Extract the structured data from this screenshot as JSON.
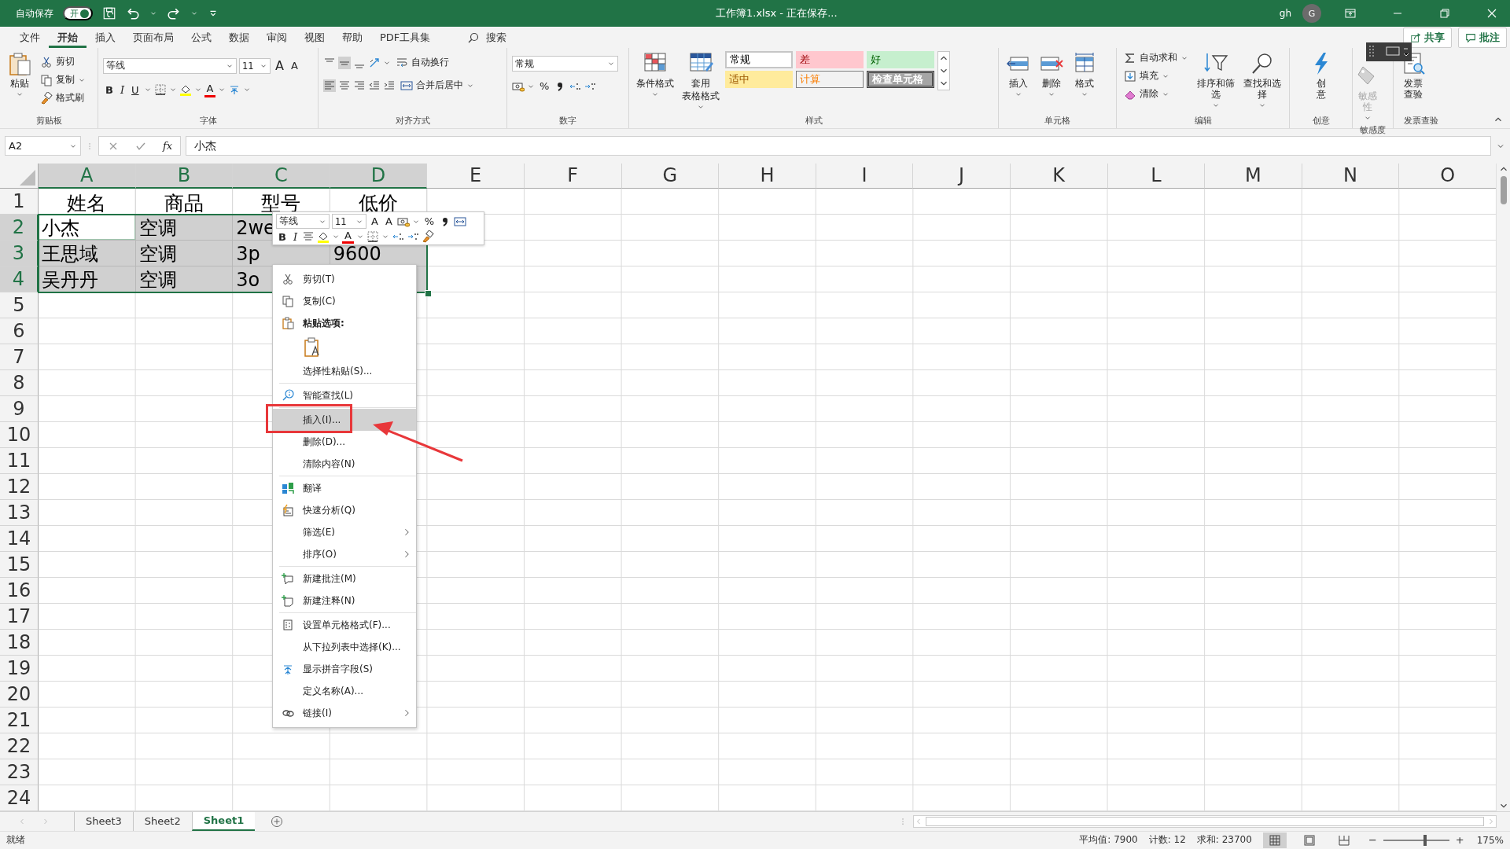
{
  "title_bar": {
    "autosave_label": "自动保存",
    "autosave": {
      "label": "开",
      "on": true
    },
    "document_title": "工作簿1.xlsx - 正在保存...",
    "user": "gh",
    "avatar": "G"
  },
  "menu_tabs": [
    {
      "label": "文件",
      "selected": false
    },
    {
      "label": "开始",
      "selected": true
    },
    {
      "label": "插入",
      "selected": false
    },
    {
      "label": "页面布局",
      "selected": false
    },
    {
      "label": "公式",
      "selected": false
    },
    {
      "label": "数据",
      "selected": false
    },
    {
      "label": "审阅",
      "selected": false
    },
    {
      "label": "视图",
      "selected": false
    },
    {
      "label": "帮助",
      "selected": false
    },
    {
      "label": "PDF工具集",
      "selected": false
    }
  ],
  "search": {
    "label": "搜索"
  },
  "share_button": "共享",
  "comment_button": "批注",
  "ribbon": {
    "clipboard": {
      "label": "剪贴板",
      "paste": "粘贴",
      "cut": "剪切",
      "copy": "复制",
      "format_painter": "格式刷"
    },
    "font": {
      "label": "字体",
      "font_name": "等线",
      "font_size": "11",
      "grow": "A",
      "shrink": "A",
      "bold": "B",
      "italic": "I",
      "underline": "U",
      "font_color": "A"
    },
    "alignment": {
      "label": "对齐方式",
      "wrap_text": "自动换行",
      "merge_center": "合并后居中"
    },
    "number": {
      "label": "数字",
      "format": "常规",
      "percent": "%"
    },
    "styles": {
      "label": "样式",
      "conditional_formatting": "条件格式",
      "format_as_table": [
        "套用",
        "表格格式"
      ],
      "cell_styles": [
        {
          "label": "常规",
          "kind": "normal"
        },
        {
          "label": "差",
          "kind": "bad"
        },
        {
          "label": "好",
          "kind": "good"
        },
        {
          "label": "适中",
          "kind": "neutral"
        },
        {
          "label": "计算",
          "kind": "calculation"
        },
        {
          "label": "检查单元格",
          "kind": "check"
        }
      ]
    },
    "cells": {
      "label": "单元格",
      "insert": "插入",
      "delete": "删除",
      "format": "格式"
    },
    "editing": {
      "label": "编辑",
      "autosum": "自动求和",
      "fill": "填充",
      "clear": "清除",
      "sort_filter": "排序和筛选",
      "find_select": "查找和选择"
    },
    "ideas": {
      "label": "创意",
      "button": "创意"
    },
    "sensitivity": {
      "label": "敏感度",
      "button": "敏感性",
      "disabled": true
    },
    "invoice": {
      "label": "发票查验",
      "button": "发票查验"
    }
  },
  "formula_bar": {
    "name_box": "A2",
    "function_label": "fx",
    "formula": "小杰"
  },
  "sheet": {
    "columns": [
      {
        "label": "A",
        "selected": true
      },
      {
        "label": "B",
        "selected": true
      },
      {
        "label": "C",
        "selected": true
      },
      {
        "label": "D",
        "selected": true
      },
      {
        "label": "E",
        "selected": false
      },
      {
        "label": "F",
        "selected": false
      },
      {
        "label": "G",
        "selected": false
      },
      {
        "label": "H",
        "selected": false
      },
      {
        "label": "I",
        "selected": false
      },
      {
        "label": "J",
        "selected": false
      },
      {
        "label": "K",
        "selected": false
      },
      {
        "label": "L",
        "selected": false
      },
      {
        "label": "M",
        "selected": false
      },
      {
        "label": "N",
        "selected": false
      },
      {
        "label": "O",
        "selected": false
      }
    ],
    "rows": [
      {
        "label": "1",
        "selected": false,
        "cells": [
          {
            "text": "姓名",
            "selected": false,
            "active": false
          },
          {
            "text": "商品",
            "selected": false,
            "active": false
          },
          {
            "text": "型号",
            "selected": false,
            "active": false
          },
          {
            "text": "低价",
            "selected": false,
            "active": false
          }
        ]
      },
      {
        "label": "2",
        "selected": true,
        "cells": [
          {
            "text": "小杰",
            "selected": true,
            "active": true
          },
          {
            "text": "空调",
            "selected": true,
            "active": false
          },
          {
            "text": "2we",
            "selected": true,
            "active": false
          }
        ]
      },
      {
        "label": "3",
        "selected": true,
        "cells": [
          {
            "text": "王思域",
            "selected": true,
            "active": false
          },
          {
            "text": "空调",
            "selected": true,
            "active": false
          },
          {
            "text": "3p",
            "selected": true,
            "active": false
          },
          {
            "text": "9600",
            "selected": true,
            "active": false
          }
        ]
      },
      {
        "label": "4",
        "selected": true,
        "cells": [
          {
            "text": "吴丹丹",
            "selected": true,
            "active": false
          },
          {
            "text": "空调",
            "selected": true,
            "active": false
          },
          {
            "text": "3o",
            "selected": true,
            "active": false
          },
          {
            "selected": true,
            "active": false
          }
        ]
      },
      {
        "label": "5",
        "selected": false
      },
      {
        "label": "6",
        "selected": false
      },
      {
        "label": "7",
        "selected": false
      },
      {
        "label": "8",
        "selected": false
      },
      {
        "label": "9",
        "selected": false
      },
      {
        "label": "10",
        "selected": false
      },
      {
        "label": "11",
        "selected": false
      },
      {
        "label": "12",
        "selected": false
      },
      {
        "label": "13",
        "selected": false
      },
      {
        "label": "14",
        "selected": false
      },
      {
        "label": "15",
        "selected": false
      },
      {
        "label": "16",
        "selected": false
      },
      {
        "label": "17",
        "selected": false
      },
      {
        "label": "18",
        "selected": false
      },
      {
        "label": "19",
        "selected": false
      },
      {
        "label": "20",
        "selected": false
      },
      {
        "label": "21",
        "selected": false
      },
      {
        "label": "22",
        "selected": false
      },
      {
        "label": "23",
        "selected": false
      },
      {
        "label": "24",
        "selected": false
      }
    ]
  },
  "mini_toolbar": {
    "font_name": "等线",
    "font_size": "11",
    "grow": "A",
    "shrink": "A",
    "percent": "%",
    "bold": "B",
    "italic": "I",
    "font_color": "A"
  },
  "context_menu": {
    "groups": [
      {
        "items": [
          {
            "kind": "cut",
            "label": "剪切(T)",
            "selected": false
          },
          {
            "kind": "copy",
            "label": "复制(C)",
            "selected": false
          },
          {
            "kind": "paste_heading",
            "label": "粘贴选项:"
          },
          {
            "kind": "paste_option"
          },
          {
            "kind": "plain",
            "label": "选择性粘贴(S)...",
            "selected": false
          }
        ]
      },
      {
        "items": [
          {
            "kind": "lookup",
            "label": "智能查找(L)",
            "selected": false
          }
        ]
      },
      {
        "items": [
          {
            "kind": "plain",
            "label": "插入(I)...",
            "selected": true
          },
          {
            "kind": "plain",
            "label": "删除(D)...",
            "selected": false
          },
          {
            "kind": "plain",
            "label": "清除内容(N)",
            "selected": false
          }
        ]
      },
      {
        "items": [
          {
            "kind": "translate",
            "label": "翻译",
            "selected": false
          },
          {
            "kind": "analysis",
            "label": "快速分析(Q)",
            "selected": false
          },
          {
            "kind": "plain",
            "label": "筛选(E)",
            "selected": false,
            "submenu": true
          },
          {
            "kind": "plain",
            "label": "排序(O)",
            "selected": false,
            "submenu": true
          }
        ]
      },
      {
        "items": [
          {
            "kind": "comment",
            "label": "新建批注(M)",
            "selected": false
          },
          {
            "kind": "note",
            "label": "新建注释(N)",
            "selected": false
          }
        ]
      },
      {
        "items": [
          {
            "kind": "format",
            "label": "设置单元格格式(F)...",
            "selected": false
          },
          {
            "kind": "plain",
            "label": "从下拉列表中选择(K)...",
            "selected": false
          },
          {
            "kind": "phonetic",
            "label": "显示拼音字段(S)",
            "selected": false
          },
          {
            "kind": "plain",
            "label": "定义名称(A)...",
            "selected": false
          },
          {
            "kind": "link",
            "label": "链接(I)",
            "selected": false,
            "submenu": true
          }
        ]
      }
    ]
  },
  "sheet_tabs": [
    {
      "label": "Sheet3",
      "selected": false
    },
    {
      "label": "Sheet2",
      "selected": false
    },
    {
      "label": "Sheet1",
      "selected": true
    }
  ],
  "status_bar": {
    "status": "就绪",
    "average": "平均值: 7900",
    "count": "计数: 12",
    "sum": "求和: 23700",
    "views": [
      {
        "kind": "normal",
        "selected": true
      },
      {
        "kind": "page_layout",
        "selected": false
      },
      {
        "kind": "page_break",
        "selected": false
      }
    ],
    "zoom_out": "−",
    "zoom_in": "+",
    "zoom": {
      "level": 0.63
    },
    "zoom_label": "175%"
  }
}
